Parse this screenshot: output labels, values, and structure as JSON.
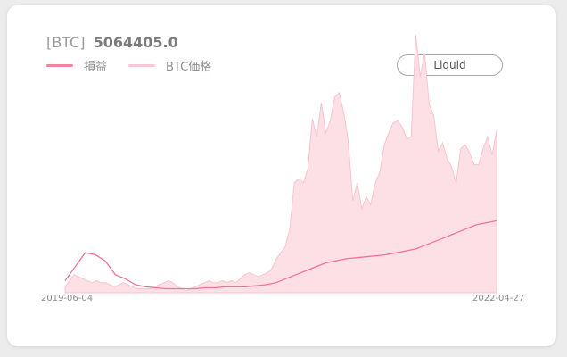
{
  "header": {
    "prefix": "[BTC]",
    "value": "5064405.0"
  },
  "legend": {
    "items": [
      {
        "label": "損益",
        "color": "#f0839e"
      },
      {
        "label": "BTC価格",
        "color": "#f8c7d2"
      }
    ]
  },
  "toolbar": {
    "liquid_label": "Liquid"
  },
  "colors": {
    "pnl_line": "#f27396",
    "price_fill": "#fde0e6",
    "price_stroke": "#f8c3cf"
  },
  "chart_data": {
    "type": "area",
    "x_start_label": "2019-06-04",
    "x_end_label": "2022-04-27",
    "y_axis_visible": false,
    "grid": false,
    "series": [
      {
        "name": "BTC価格",
        "style": "area",
        "values": [
          0.03,
          0.06,
          0.09,
          0.08,
          0.07,
          0.06,
          0.05,
          0.06,
          0.05,
          0.05,
          0.04,
          0.03,
          0.04,
          0.05,
          0.04,
          0.03,
          0.02,
          0.02,
          0.02,
          0.02,
          0.03,
          0.04,
          0.05,
          0.06,
          0.05,
          0.03,
          0.02,
          0.01,
          0.02,
          0.03,
          0.04,
          0.05,
          0.06,
          0.05,
          0.05,
          0.06,
          0.05,
          0.06,
          0.05,
          0.07,
          0.09,
          0.1,
          0.09,
          0.08,
          0.09,
          0.1,
          0.12,
          0.17,
          0.2,
          0.23,
          0.32,
          0.55,
          0.57,
          0.55,
          0.62,
          0.87,
          0.78,
          0.95,
          0.8,
          0.86,
          0.98,
          1.0,
          0.9,
          0.76,
          0.46,
          0.55,
          0.42,
          0.48,
          0.44,
          0.55,
          0.6,
          0.74,
          0.8,
          0.85,
          0.86,
          0.83,
          0.77,
          0.78,
          1.29,
          1.08,
          1.2,
          0.94,
          0.89,
          0.71,
          0.75,
          0.67,
          0.63,
          0.55,
          0.72,
          0.74,
          0.7,
          0.64,
          0.64,
          0.72,
          0.78,
          0.69,
          0.81
        ]
      },
      {
        "name": "損益",
        "style": "line",
        "values": [
          0.06,
          0.13,
          0.2,
          0.19,
          0.16,
          0.09,
          0.07,
          0.04,
          0.03,
          0.025,
          0.02,
          0.02,
          0.02,
          0.02,
          0.025,
          0.025,
          0.03,
          0.03,
          0.03,
          0.035,
          0.04,
          0.05,
          0.07,
          0.09,
          0.11,
          0.13,
          0.15,
          0.16,
          0.17,
          0.175,
          0.18,
          0.185,
          0.19,
          0.2,
          0.21,
          0.22,
          0.24,
          0.26,
          0.28,
          0.3,
          0.32,
          0.34,
          0.35,
          0.36
        ]
      }
    ]
  }
}
